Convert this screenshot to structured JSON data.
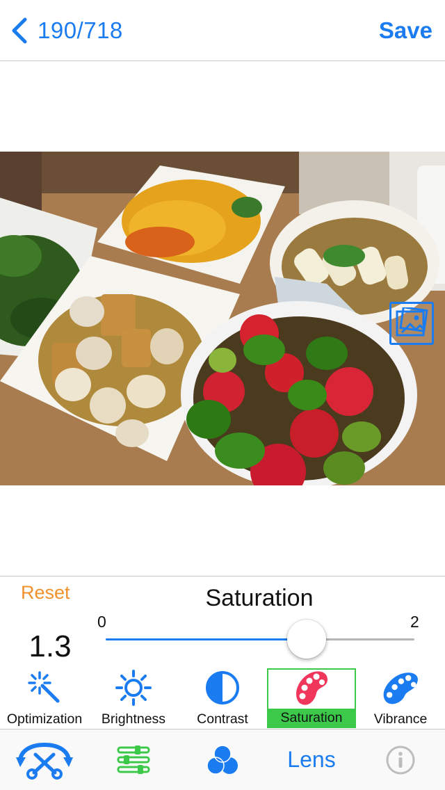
{
  "nav": {
    "back_icon": "chevron-left-icon",
    "counter": "190/718",
    "save_label": "Save"
  },
  "photo": {
    "badge_icon": "image-badge-icon"
  },
  "adjust": {
    "reset_label": "Reset",
    "title": "Saturation",
    "value": "1.3",
    "slider": {
      "min_label": "0",
      "max_label": "2",
      "min": 0,
      "max": 2,
      "current": 1.3
    }
  },
  "tools": [
    {
      "label": "Optimization",
      "icon": "magic-wand-icon",
      "selected": false
    },
    {
      "label": "Brightness",
      "icon": "sun-icon",
      "selected": false
    },
    {
      "label": "Contrast",
      "icon": "half-circle-icon",
      "selected": false
    },
    {
      "label": "Saturation",
      "icon": "palette-icon",
      "selected": true
    },
    {
      "label": "Vibrance",
      "icon": "palette-icon",
      "selected": false
    }
  ],
  "tabbar": {
    "tabs": [
      {
        "icon": "crop-rotate-icon"
      },
      {
        "icon": "sliders-icon"
      },
      {
        "icon": "color-circles-icon"
      },
      {
        "label": "Lens"
      },
      {
        "icon": "info-icon"
      }
    ]
  },
  "colors": {
    "accent": "#1a7cf0",
    "reset": "#f0912c",
    "selected": "#3cc94a",
    "saturation_icon": "#f0365a",
    "adjust_icons": "#1a7cf0",
    "sliders_tab": "#3cc94a"
  }
}
